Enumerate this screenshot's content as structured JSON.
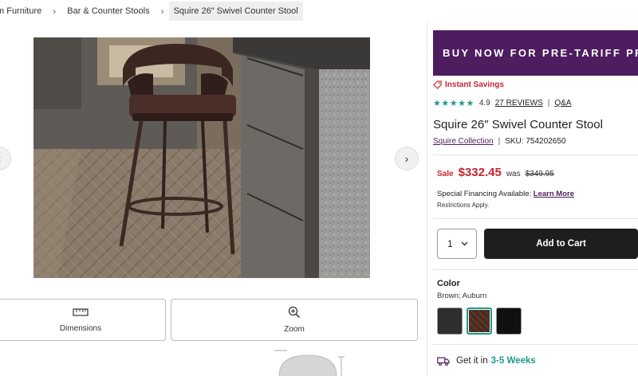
{
  "breadcrumbs": [
    {
      "label": "m Furniture"
    },
    {
      "label": "Bar & Counter Stools"
    },
    {
      "label": "Squire 26″ Swivel Counter Stool"
    }
  ],
  "gallery": {
    "prev_icon": "chevron-left-icon",
    "next_icon": "chevron-right-icon"
  },
  "tools": {
    "dimensions_label": "Dimensions",
    "zoom_label": "Zoom"
  },
  "promo_banner": "BUY NOW FOR PRE-TARIFF PRI",
  "savings_label": "Instant Savings",
  "rating": {
    "stars_text": "★★★★★",
    "score": "4.9",
    "reviews_link": "27 REVIEWS",
    "qa_link": "Q&A"
  },
  "product": {
    "title": "Squire 26″ Swivel Counter Stool",
    "collection_link": "Squire Collection",
    "sku": "SKU: 754202650"
  },
  "pricing": {
    "sale_tag": "Sale",
    "price": "$332.45",
    "was_label": "was",
    "was_price": "$349.95"
  },
  "financing": {
    "text": "Special Financing Available:",
    "link": "Learn More",
    "restrictions": "Restrictions Apply."
  },
  "purchase": {
    "quantity": "1",
    "add_to_cart": "Add to Cart"
  },
  "color": {
    "heading": "Color",
    "selected": "Brown; Auburn",
    "swatches": [
      {
        "name": "charcoal",
        "hex": "#2e2e2e"
      },
      {
        "name": "brown-auburn",
        "hex": "#4a2a1f",
        "selected": true
      },
      {
        "name": "black",
        "hex": "#101010"
      }
    ]
  },
  "shipping": {
    "prefix": "Get it in",
    "weeks": "3-5 Weeks"
  },
  "colors": {
    "brand_purple": "#4d1d5f",
    "sale_red": "#c4262e",
    "teal": "#1c9a8e",
    "button_dark": "#1e1e1e"
  }
}
